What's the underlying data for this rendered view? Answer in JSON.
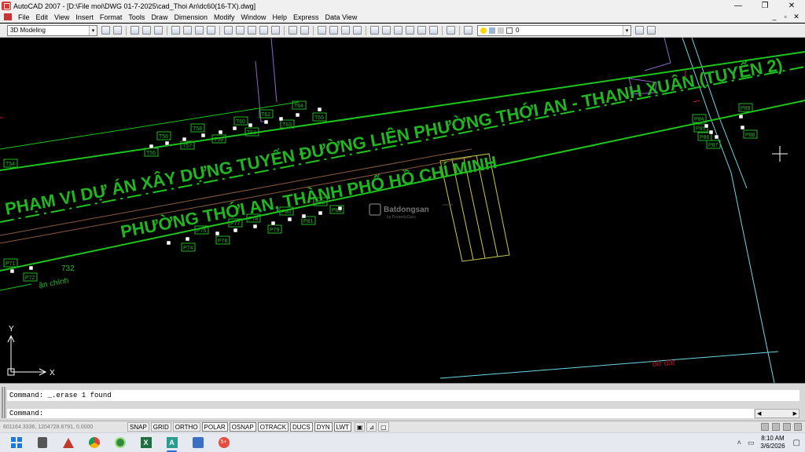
{
  "window": {
    "title": "AutoCAD 2007 - [D:\\File moi\\DWG 01-7-2025\\cad_Thoi An\\dc60(16-TX).dwg]",
    "minimize": "—",
    "restore": "❐",
    "close": "✕"
  },
  "menu": {
    "items": [
      "File",
      "Edit",
      "View",
      "Insert",
      "Format",
      "Tools",
      "Draw",
      "Dimension",
      "Modify",
      "Window",
      "Help",
      "Express",
      "Data View"
    ],
    "mdi_min": "_",
    "mdi_restore": "▫",
    "mdi_close": "✕"
  },
  "toolbar": {
    "workspace": "3D Modeling",
    "layer": "0",
    "dropdown_arrow": "▾"
  },
  "drawing": {
    "title_line1": "PHẠM VI DỰ ÁN XÂY DỰNG TUYẾN ĐƯỜNG LIÊN PHƯỜNG THỚI AN - THẠNH XUÂN (TUYẾN 2)",
    "title_line2": "PHƯỜNG THỚI AN, THÀNH PHỐ HỒ CHÍ MINH",
    "label_732": "732",
    "label_an_chinh": "ận chính",
    "label_bo_dat": "bờ đất",
    "watermark": "Batdongsan",
    "watermark_sub": "by PropertyGuru",
    "watermark_domain": ".com.vn",
    "ucs_x": "X",
    "ucs_y": "Y",
    "points_upper": [
      "T54",
      "T55",
      "T56",
      "T57",
      "T58",
      "T59",
      "T60",
      "T61",
      "T62",
      "T63",
      "T64",
      "T65"
    ],
    "points_lower": [
      "P74",
      "P75",
      "P76",
      "P77",
      "P78",
      "P79",
      "P80",
      "P81",
      "P82",
      "P83"
    ],
    "points_left": [
      "P71",
      "P72"
    ],
    "points_right": [
      "P84",
      "P85",
      "P86",
      "P87",
      "P88",
      "P89"
    ]
  },
  "command": {
    "history": "Command: _.erase 1 found",
    "prompt": "Command:",
    "scroll_left": "◀",
    "scroll_right": "▶"
  },
  "status": {
    "coords": "601164.3336, 1204728.6791, 0.0000",
    "buttons": [
      "SNAP",
      "GRID",
      "ORTHO",
      "POLAR",
      "OSNAP",
      "OTRACK",
      "DUCS",
      "DYN",
      "LWT"
    ],
    "active": [
      "POLAR",
      "OSNAP",
      "OTRACK",
      "DUCS",
      "DYN",
      "LWT"
    ]
  },
  "taskbar": {
    "apps": [
      "search-app",
      "calculator-app",
      "autocad-app",
      "chrome-app",
      "coccoc-app",
      "excel-app",
      "word-app",
      "autocad-2007-app",
      "messenger-app"
    ],
    "time": "8:10 AM",
    "date": "3/6/2026",
    "badge": "5+"
  },
  "colors": {
    "road_line": "#1dc51d",
    "text_green": "#22b522",
    "boundary_cyan": "#6fd7e6",
    "crosshair": "#ffffff"
  }
}
